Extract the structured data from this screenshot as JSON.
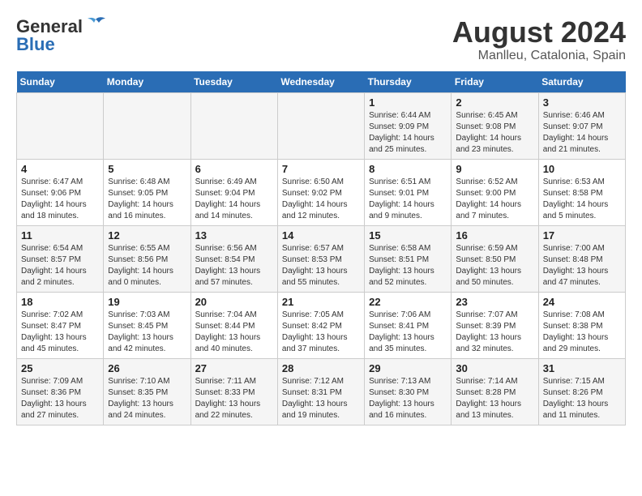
{
  "header": {
    "logo_general": "General",
    "logo_blue": "Blue",
    "title": "August 2024",
    "subtitle": "Manlleu, Catalonia, Spain"
  },
  "calendar": {
    "weekdays": [
      "Sunday",
      "Monday",
      "Tuesday",
      "Wednesday",
      "Thursday",
      "Friday",
      "Saturday"
    ],
    "weeks": [
      [
        {
          "day": "",
          "info": ""
        },
        {
          "day": "",
          "info": ""
        },
        {
          "day": "",
          "info": ""
        },
        {
          "day": "",
          "info": ""
        },
        {
          "day": "1",
          "info": "Sunrise: 6:44 AM\nSunset: 9:09 PM\nDaylight: 14 hours\nand 25 minutes."
        },
        {
          "day": "2",
          "info": "Sunrise: 6:45 AM\nSunset: 9:08 PM\nDaylight: 14 hours\nand 23 minutes."
        },
        {
          "day": "3",
          "info": "Sunrise: 6:46 AM\nSunset: 9:07 PM\nDaylight: 14 hours\nand 21 minutes."
        }
      ],
      [
        {
          "day": "4",
          "info": "Sunrise: 6:47 AM\nSunset: 9:06 PM\nDaylight: 14 hours\nand 18 minutes."
        },
        {
          "day": "5",
          "info": "Sunrise: 6:48 AM\nSunset: 9:05 PM\nDaylight: 14 hours\nand 16 minutes."
        },
        {
          "day": "6",
          "info": "Sunrise: 6:49 AM\nSunset: 9:04 PM\nDaylight: 14 hours\nand 14 minutes."
        },
        {
          "day": "7",
          "info": "Sunrise: 6:50 AM\nSunset: 9:02 PM\nDaylight: 14 hours\nand 12 minutes."
        },
        {
          "day": "8",
          "info": "Sunrise: 6:51 AM\nSunset: 9:01 PM\nDaylight: 14 hours\nand 9 minutes."
        },
        {
          "day": "9",
          "info": "Sunrise: 6:52 AM\nSunset: 9:00 PM\nDaylight: 14 hours\nand 7 minutes."
        },
        {
          "day": "10",
          "info": "Sunrise: 6:53 AM\nSunset: 8:58 PM\nDaylight: 14 hours\nand 5 minutes."
        }
      ],
      [
        {
          "day": "11",
          "info": "Sunrise: 6:54 AM\nSunset: 8:57 PM\nDaylight: 14 hours\nand 2 minutes."
        },
        {
          "day": "12",
          "info": "Sunrise: 6:55 AM\nSunset: 8:56 PM\nDaylight: 14 hours\nand 0 minutes."
        },
        {
          "day": "13",
          "info": "Sunrise: 6:56 AM\nSunset: 8:54 PM\nDaylight: 13 hours\nand 57 minutes."
        },
        {
          "day": "14",
          "info": "Sunrise: 6:57 AM\nSunset: 8:53 PM\nDaylight: 13 hours\nand 55 minutes."
        },
        {
          "day": "15",
          "info": "Sunrise: 6:58 AM\nSunset: 8:51 PM\nDaylight: 13 hours\nand 52 minutes."
        },
        {
          "day": "16",
          "info": "Sunrise: 6:59 AM\nSunset: 8:50 PM\nDaylight: 13 hours\nand 50 minutes."
        },
        {
          "day": "17",
          "info": "Sunrise: 7:00 AM\nSunset: 8:48 PM\nDaylight: 13 hours\nand 47 minutes."
        }
      ],
      [
        {
          "day": "18",
          "info": "Sunrise: 7:02 AM\nSunset: 8:47 PM\nDaylight: 13 hours\nand 45 minutes."
        },
        {
          "day": "19",
          "info": "Sunrise: 7:03 AM\nSunset: 8:45 PM\nDaylight: 13 hours\nand 42 minutes."
        },
        {
          "day": "20",
          "info": "Sunrise: 7:04 AM\nSunset: 8:44 PM\nDaylight: 13 hours\nand 40 minutes."
        },
        {
          "day": "21",
          "info": "Sunrise: 7:05 AM\nSunset: 8:42 PM\nDaylight: 13 hours\nand 37 minutes."
        },
        {
          "day": "22",
          "info": "Sunrise: 7:06 AM\nSunset: 8:41 PM\nDaylight: 13 hours\nand 35 minutes."
        },
        {
          "day": "23",
          "info": "Sunrise: 7:07 AM\nSunset: 8:39 PM\nDaylight: 13 hours\nand 32 minutes."
        },
        {
          "day": "24",
          "info": "Sunrise: 7:08 AM\nSunset: 8:38 PM\nDaylight: 13 hours\nand 29 minutes."
        }
      ],
      [
        {
          "day": "25",
          "info": "Sunrise: 7:09 AM\nSunset: 8:36 PM\nDaylight: 13 hours\nand 27 minutes."
        },
        {
          "day": "26",
          "info": "Sunrise: 7:10 AM\nSunset: 8:35 PM\nDaylight: 13 hours\nand 24 minutes."
        },
        {
          "day": "27",
          "info": "Sunrise: 7:11 AM\nSunset: 8:33 PM\nDaylight: 13 hours\nand 22 minutes."
        },
        {
          "day": "28",
          "info": "Sunrise: 7:12 AM\nSunset: 8:31 PM\nDaylight: 13 hours\nand 19 minutes."
        },
        {
          "day": "29",
          "info": "Sunrise: 7:13 AM\nSunset: 8:30 PM\nDaylight: 13 hours\nand 16 minutes."
        },
        {
          "day": "30",
          "info": "Sunrise: 7:14 AM\nSunset: 8:28 PM\nDaylight: 13 hours\nand 13 minutes."
        },
        {
          "day": "31",
          "info": "Sunrise: 7:15 AM\nSunset: 8:26 PM\nDaylight: 13 hours\nand 11 minutes."
        }
      ]
    ]
  }
}
